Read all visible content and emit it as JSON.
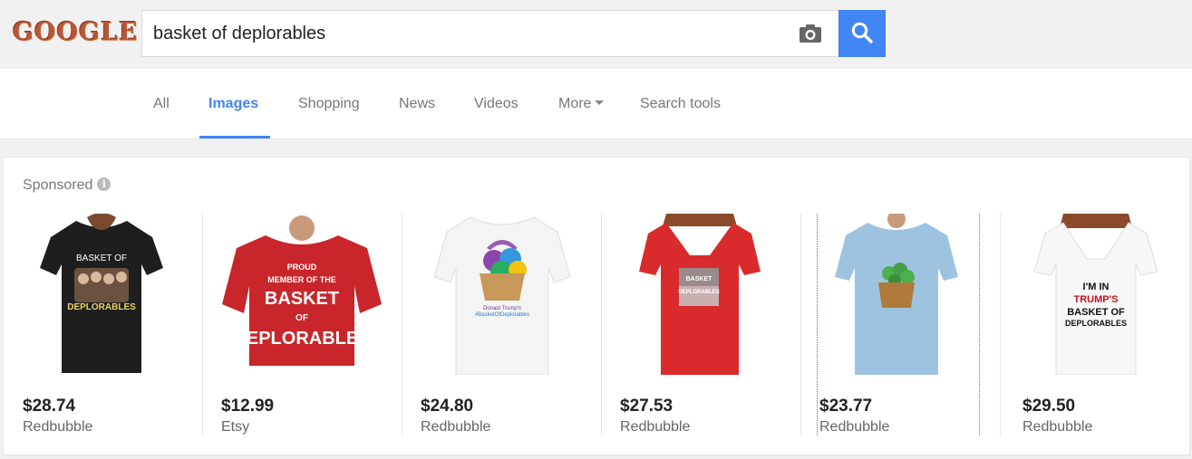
{
  "header": {
    "logo": "GOOGLE",
    "search_value": "basket of deplorables"
  },
  "tabs": [
    {
      "label": "All"
    },
    {
      "label": "Images",
      "active": true
    },
    {
      "label": "Shopping"
    },
    {
      "label": "News"
    },
    {
      "label": "Videos"
    },
    {
      "label": "More"
    },
    {
      "label": "Search tools"
    }
  ],
  "sponsored": {
    "label": "Sponsored",
    "products": [
      {
        "price": "$28.74",
        "seller": "Redbubble",
        "shirt_color": "#1e1e1e",
        "print_text": [
          "BASKET OF",
          "DEPLORABLES"
        ]
      },
      {
        "price": "$12.99",
        "seller": "Etsy",
        "shirt_color": "#c8262a",
        "print_text": [
          "PROUD",
          "MEMBER OF THE",
          "BASKET",
          "OF",
          "DEPLORABLES"
        ]
      },
      {
        "price": "$24.80",
        "seller": "Redbubble",
        "shirt_color": "#f4f4f4",
        "print_text": [
          "Donald Trump's",
          "#BasketOfDeplorables"
        ]
      },
      {
        "price": "$27.53",
        "seller": "Redbubble",
        "shirt_color": "#d92b2b",
        "print_text": [
          "BASKET",
          "DEPLORABLES"
        ]
      },
      {
        "price": "$23.77",
        "seller": "Redbubble",
        "shirt_color": "#9ec3e1",
        "print_text": []
      },
      {
        "price": "$29.50",
        "seller": "Redbubble",
        "shirt_color": "#f7f7f7",
        "print_text": [
          "I'M IN",
          "TRUMP'S",
          "BASKET OF",
          "DEPLORABLES"
        ]
      }
    ]
  },
  "colors": {
    "accent": "#4285f4",
    "logo": "#b5573a"
  }
}
